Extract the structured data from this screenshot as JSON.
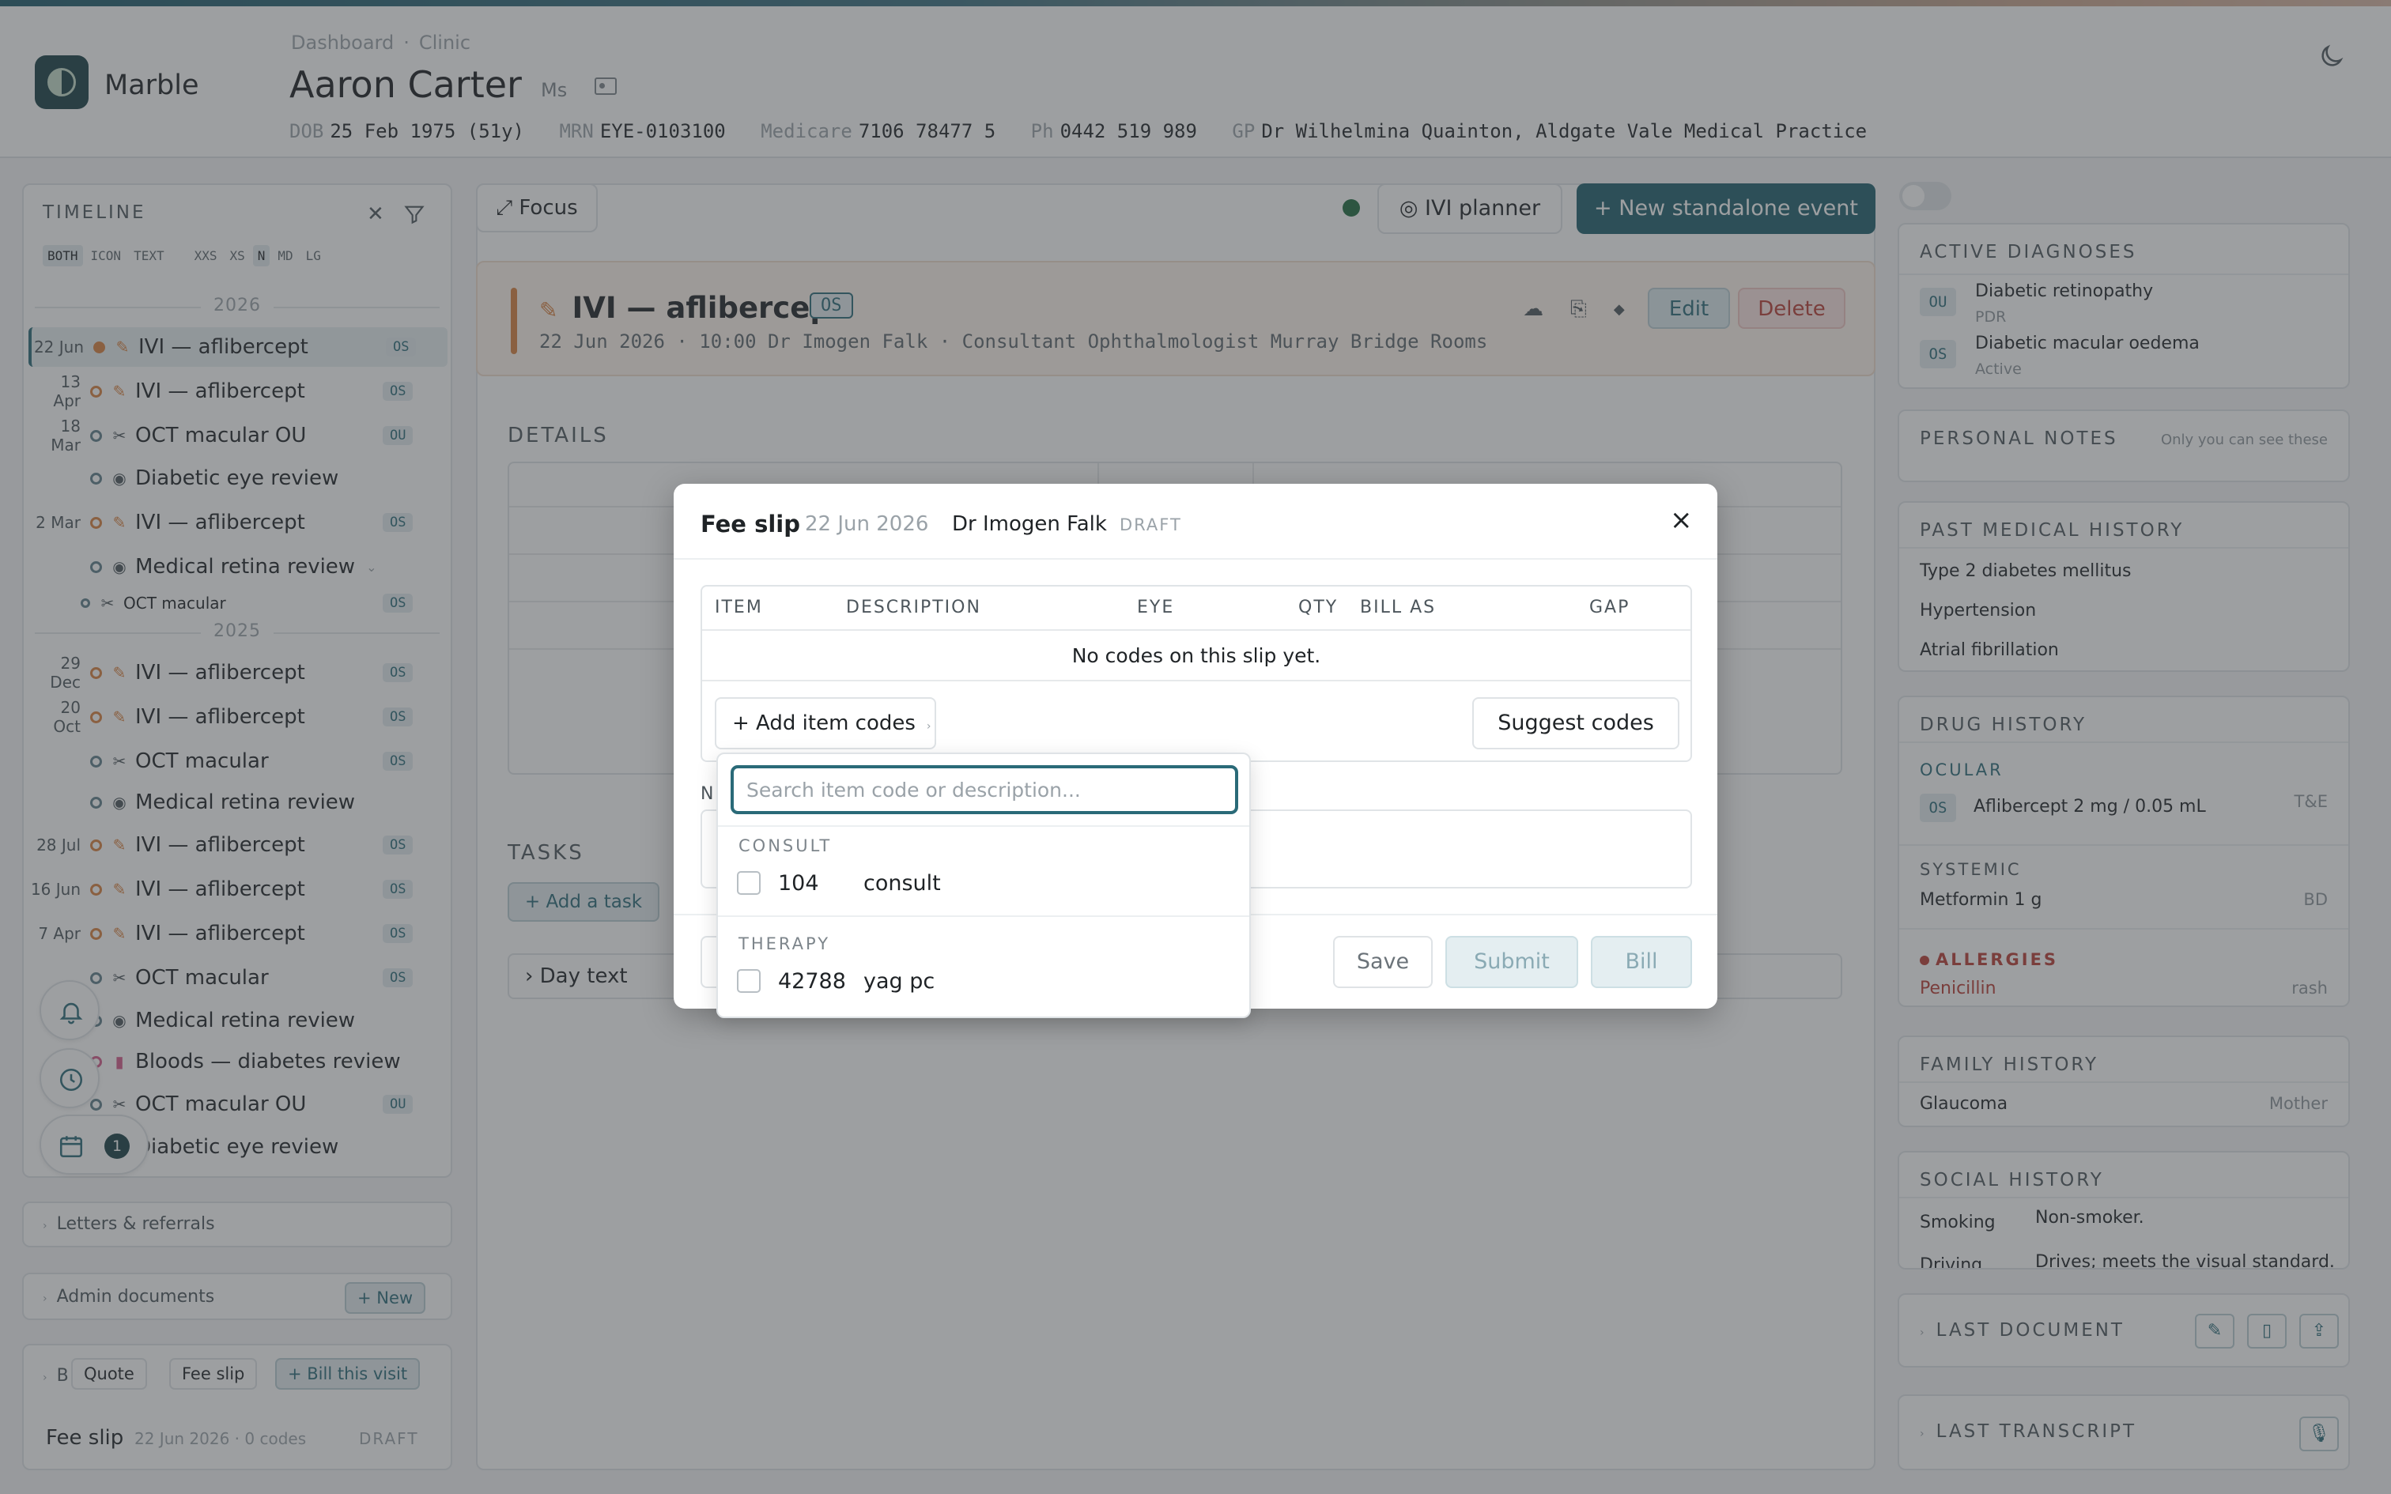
{
  "app": {
    "brand": "Marble"
  },
  "breadcrumb": [
    "Dashboard",
    "Clinic"
  ],
  "patient": {
    "name": "Aaron Carter",
    "title": "Ms",
    "dob_label": "DOB",
    "dob": "25 Feb 1975 (51y)",
    "mrn_label": "MRN",
    "mrn": "EYE-0103100",
    "medicare_label": "Medicare",
    "medicare": "7106 78477 5",
    "ph_label": "Ph",
    "ph": "0442 519 989",
    "gp_label": "GP",
    "gp": "Dr Wilhelmina Quainton, Aldgate Vale Medical Practice"
  },
  "timeline": {
    "title": "TIMELINE",
    "modes": [
      "BOTH",
      "ICON",
      "TEXT"
    ],
    "sizes": [
      "XXS",
      "XS",
      "N",
      "MD",
      "LG"
    ],
    "year_2026": "2026",
    "year_2025": "2025",
    "events": [
      {
        "date": "22 Jun",
        "label": "IVI — aflibercept",
        "eye": "OS",
        "icon": "pencil-icon"
      },
      {
        "date": "13 Apr",
        "label": "IVI — aflibercept",
        "eye": "OS",
        "icon": "pencil-icon"
      },
      {
        "date": "18 Mar",
        "label": "OCT macular OU",
        "eye": "OU",
        "icon": "scan-icon"
      },
      {
        "date": "",
        "label": "Diabetic eye review",
        "eye": "",
        "icon": "eye-icon"
      },
      {
        "date": "2 Mar",
        "label": "IVI — aflibercept",
        "eye": "OS",
        "icon": "pencil-icon"
      },
      {
        "date": "",
        "label": "Medical retina review",
        "eye": "",
        "icon": "eye-icon"
      },
      {
        "date": "",
        "label": "OCT macular",
        "eye": "OS",
        "icon": "scan-icon"
      },
      {
        "date": "29 Dec",
        "label": "IVI — aflibercept",
        "eye": "OS",
        "icon": "pencil-icon"
      },
      {
        "date": "20 Oct",
        "label": "IVI — aflibercept",
        "eye": "OS",
        "icon": "pencil-icon"
      },
      {
        "date": "",
        "label": "OCT macular",
        "eye": "OS",
        "icon": "scan-icon"
      },
      {
        "date": "",
        "label": "Medical retina review",
        "eye": "",
        "icon": "eye-icon"
      },
      {
        "date": "28 Jul",
        "label": "IVI — aflibercept",
        "eye": "OS",
        "icon": "pencil-icon"
      },
      {
        "date": "16 Jun",
        "label": "IVI — aflibercept",
        "eye": "OS",
        "icon": "pencil-icon"
      },
      {
        "date": "7 Apr",
        "label": "IVI — aflibercept",
        "eye": "OS",
        "icon": "pencil-icon"
      },
      {
        "date": "",
        "label": "OCT macular",
        "eye": "OS",
        "icon": "scan-icon"
      },
      {
        "date": "",
        "label": "Medical retina review",
        "eye": "",
        "icon": "eye-icon"
      },
      {
        "date": "",
        "label": "Bloods — diabetes review",
        "eye": "",
        "icon": "vial-icon"
      },
      {
        "date": "",
        "label": "OCT macular OU",
        "eye": "OU",
        "icon": "scan-icon"
      },
      {
        "date": "",
        "label": "Diabetic eye review",
        "eye": "",
        "icon": "eye-icon"
      }
    ],
    "calendar_count": "1"
  },
  "left_sections": {
    "letters": "Letters & referrals",
    "admin": "Admin documents",
    "admin_new": "+ New",
    "billing_prefix": "B",
    "quote": "Quote",
    "fee_slip": "Fee slip",
    "bill_visit": "+ Bill this visit",
    "slip_title": "Fee slip",
    "slip_meta": "22 Jun 2026 · 0 codes",
    "slip_status": "DRAFT"
  },
  "toolbar": {
    "focus": "⤢ Focus",
    "ivi_planner": "◎ IVI planner",
    "new_event": "+ New standalone event"
  },
  "event": {
    "title": "IVI — aflibercept",
    "eye": "OS",
    "meta": "22 Jun 2026 · 10:00   Dr Imogen Falk · Consultant Ophthalmologist   Murray Bridge Rooms",
    "edit": "Edit",
    "delete": "Delete"
  },
  "details_title": "DETAILS",
  "tasks": {
    "title": "TASKS",
    "add": "+ Add a task",
    "day_text": "› Day text"
  },
  "right": {
    "diagnoses_title": "ACTIVE DIAGNOSES",
    "diagnoses": [
      {
        "eye": "OU",
        "name": "Diabetic retinopathy",
        "sub": "PDR"
      },
      {
        "eye": "OS",
        "name": "Diabetic macular oedema",
        "sub": "Active"
      }
    ],
    "notes_title": "PERSONAL NOTES",
    "notes_hint": "Only you can see these",
    "pmh_title": "PAST MEDICAL HISTORY",
    "pmh": [
      "Type 2 diabetes mellitus",
      "Hypertension",
      "Atrial fibrillation"
    ],
    "drug_title": "DRUG HISTORY",
    "ocular_label": "OCULAR",
    "ocular_eye": "OS",
    "ocular_drug": "Aflibercept 2 mg / 0.05 mL",
    "ocular_regimen": "T&E",
    "systemic_label": "SYSTEMIC",
    "systemic_drug": "Metformin 1 g",
    "systemic_freq": "BD",
    "allergies_label": "ALLERGIES",
    "allergy": "Penicillin",
    "allergy_reaction": "rash",
    "family_title": "FAMILY HISTORY",
    "family_item": "Glaucoma",
    "family_rel": "Mother",
    "social_title": "SOCIAL HISTORY",
    "smoking_label": "Smoking",
    "smoking_val": "Non-smoker.",
    "driving_label": "Driving",
    "driving_val": "Drives; meets the visual standard.",
    "last_doc": "LAST DOCUMENT",
    "last_transcript": "LAST TRANSCRIPT"
  },
  "modal": {
    "title": "Fee slip",
    "date": "22 Jun 2026",
    "doctor": "Dr Imogen Falk",
    "status": "DRAFT",
    "columns": [
      "ITEM",
      "DESCRIPTION",
      "EYE",
      "QTY",
      "BILL AS",
      "GAP"
    ],
    "empty": "No codes on this slip yet.",
    "add_codes": "+ Add item codes",
    "suggest": "Suggest codes",
    "notes_label": "N",
    "save": "Save",
    "submit": "Submit",
    "bill": "Bill"
  },
  "dropdown": {
    "placeholder": "Search item code or description...",
    "groups": [
      {
        "name": "CONSULT",
        "options": [
          {
            "code": "104",
            "desc": "consult"
          }
        ]
      },
      {
        "name": "THERAPY",
        "options": [
          {
            "code": "42788",
            "desc": "yag pc"
          }
        ]
      }
    ]
  },
  "colors": {
    "accent": "#1e5f6c",
    "warning": "#d9813f",
    "danger": "#b83c34"
  }
}
